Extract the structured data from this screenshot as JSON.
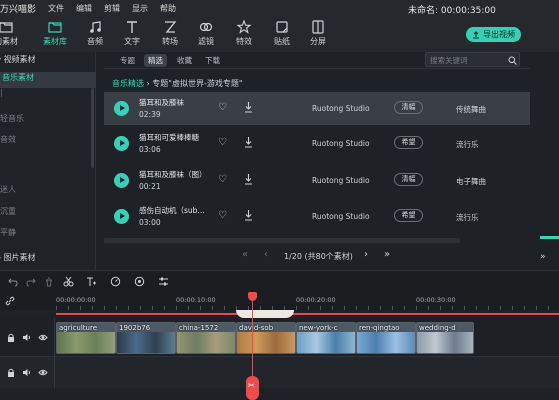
{
  "menubar": {
    "logo": "万兴喵影",
    "items": [
      "文件",
      "编辑",
      "剪辑",
      "显示",
      "帮助"
    ],
    "project_title": "未命名: 00:00:35:00"
  },
  "toolbar": {
    "tools": [
      {
        "label": "的素材",
        "icon": "folder-icon"
      },
      {
        "label": "素材库",
        "icon": "library-icon"
      },
      {
        "label": "音频",
        "icon": "music-icon"
      },
      {
        "label": "文字",
        "icon": "text-icon"
      },
      {
        "label": "转场",
        "icon": "transition-icon"
      },
      {
        "label": "滤镜",
        "icon": "filter-icon"
      },
      {
        "label": "特效",
        "icon": "effects-icon"
      },
      {
        "label": "贴纸",
        "icon": "sticker-icon"
      },
      {
        "label": "分屏",
        "icon": "split-screen-icon"
      }
    ],
    "active_tool": "素材库",
    "export_label": "导出视频"
  },
  "left_panel": {
    "video_section": "视频素材",
    "items": [
      "音乐素材",
      "轻音乐",
      "音效",
      "迷人",
      "沉重",
      "平静"
    ],
    "image_section": "图片素材"
  },
  "tabs": {
    "items": [
      "专题",
      "精选",
      "收藏",
      "下载"
    ],
    "active": "精选"
  },
  "search": {
    "placeholder": "搜索关键词"
  },
  "breadcrumb": {
    "root": "音乐精选",
    "separator": "›",
    "current": "专题\"虚拟世界-游戏专题\""
  },
  "tracks": [
    {
      "title": "猫耳和及膝袜",
      "duration": "02:39",
      "artist": "Ruotong Studio",
      "mood": "清幅",
      "genre": "传统舞曲",
      "selected": true
    },
    {
      "title": "猫耳和可爱棒棒糖",
      "duration": "03:06",
      "artist": "Ruotong Studio",
      "mood": "希望",
      "genre": "流行乐",
      "selected": false
    },
    {
      "title": "猫耳和及膝袜（图）",
      "duration": "00:21",
      "artist": "Ruotong Studio",
      "mood": "清幅",
      "genre": "电子舞曲",
      "selected": false
    },
    {
      "title": "感伤自动机（sub…",
      "duration": "03:00",
      "artist": "Ruotong Studio",
      "mood": "希望",
      "genre": "流行乐",
      "selected": false
    }
  ],
  "pager": {
    "text": "1/20 (共80个素材)"
  },
  "timeline": {
    "ruler_ticks": [
      "00:00:00:00",
      "00:00:10:00",
      "00:00:20:00",
      "00:00:30:00"
    ],
    "clips": [
      {
        "label": "agriculture",
        "color": "#6a7c57"
      },
      {
        "label": "1902b76",
        "color": "#3f5b73"
      },
      {
        "label": "china-1572",
        "color": "#8a8f6a"
      },
      {
        "label": "david-sob",
        "color": "#a87b4e"
      },
      {
        "label": "new-york-c",
        "color": "#5b8fb8"
      },
      {
        "label": "ren-qingtao",
        "color": "#6d9ac4"
      },
      {
        "label": "wedding-d",
        "color": "#7b8a9a"
      }
    ]
  },
  "colors": {
    "accent": "#3ed3b9",
    "playhead": "#f04a4a",
    "panel": "#1e2125"
  }
}
